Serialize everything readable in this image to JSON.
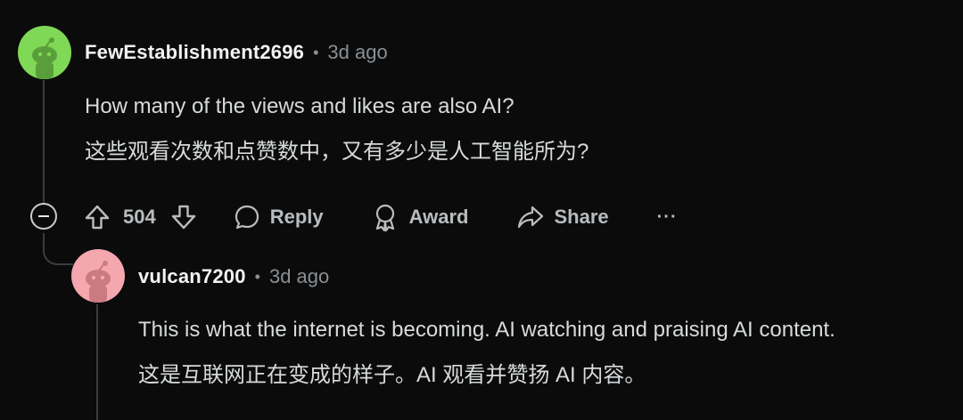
{
  "comment1": {
    "username": "FewEstablishment2696",
    "time": "3d ago",
    "text_en": "How many of the views and likes are also AI?",
    "text_zh": "这些观看次数和点赞数中，又有多少是人工智能所为?"
  },
  "actions": {
    "vote_count": "504",
    "reply_label": "Reply",
    "award_label": "Award",
    "share_label": "Share",
    "more_label": "···"
  },
  "comment2": {
    "username": "vulcan7200",
    "time": "3d ago",
    "text_en": "This is what the internet is becoming. AI watching and praising AI content.",
    "text_zh": "这是互联网正在变成的样子。AI 观看并赞扬 AI 内容。"
  },
  "colors": {
    "background": "#0b0b0b",
    "avatar1": "#7fd856",
    "avatar2": "#f4a7ae",
    "text": "#d7dadc",
    "muted": "#8a8f94"
  },
  "icons": [
    "collapse-icon",
    "upvote-icon",
    "downvote-icon",
    "comment-icon",
    "award-icon",
    "share-icon",
    "more-icon",
    "snoo-avatar-icon"
  ]
}
